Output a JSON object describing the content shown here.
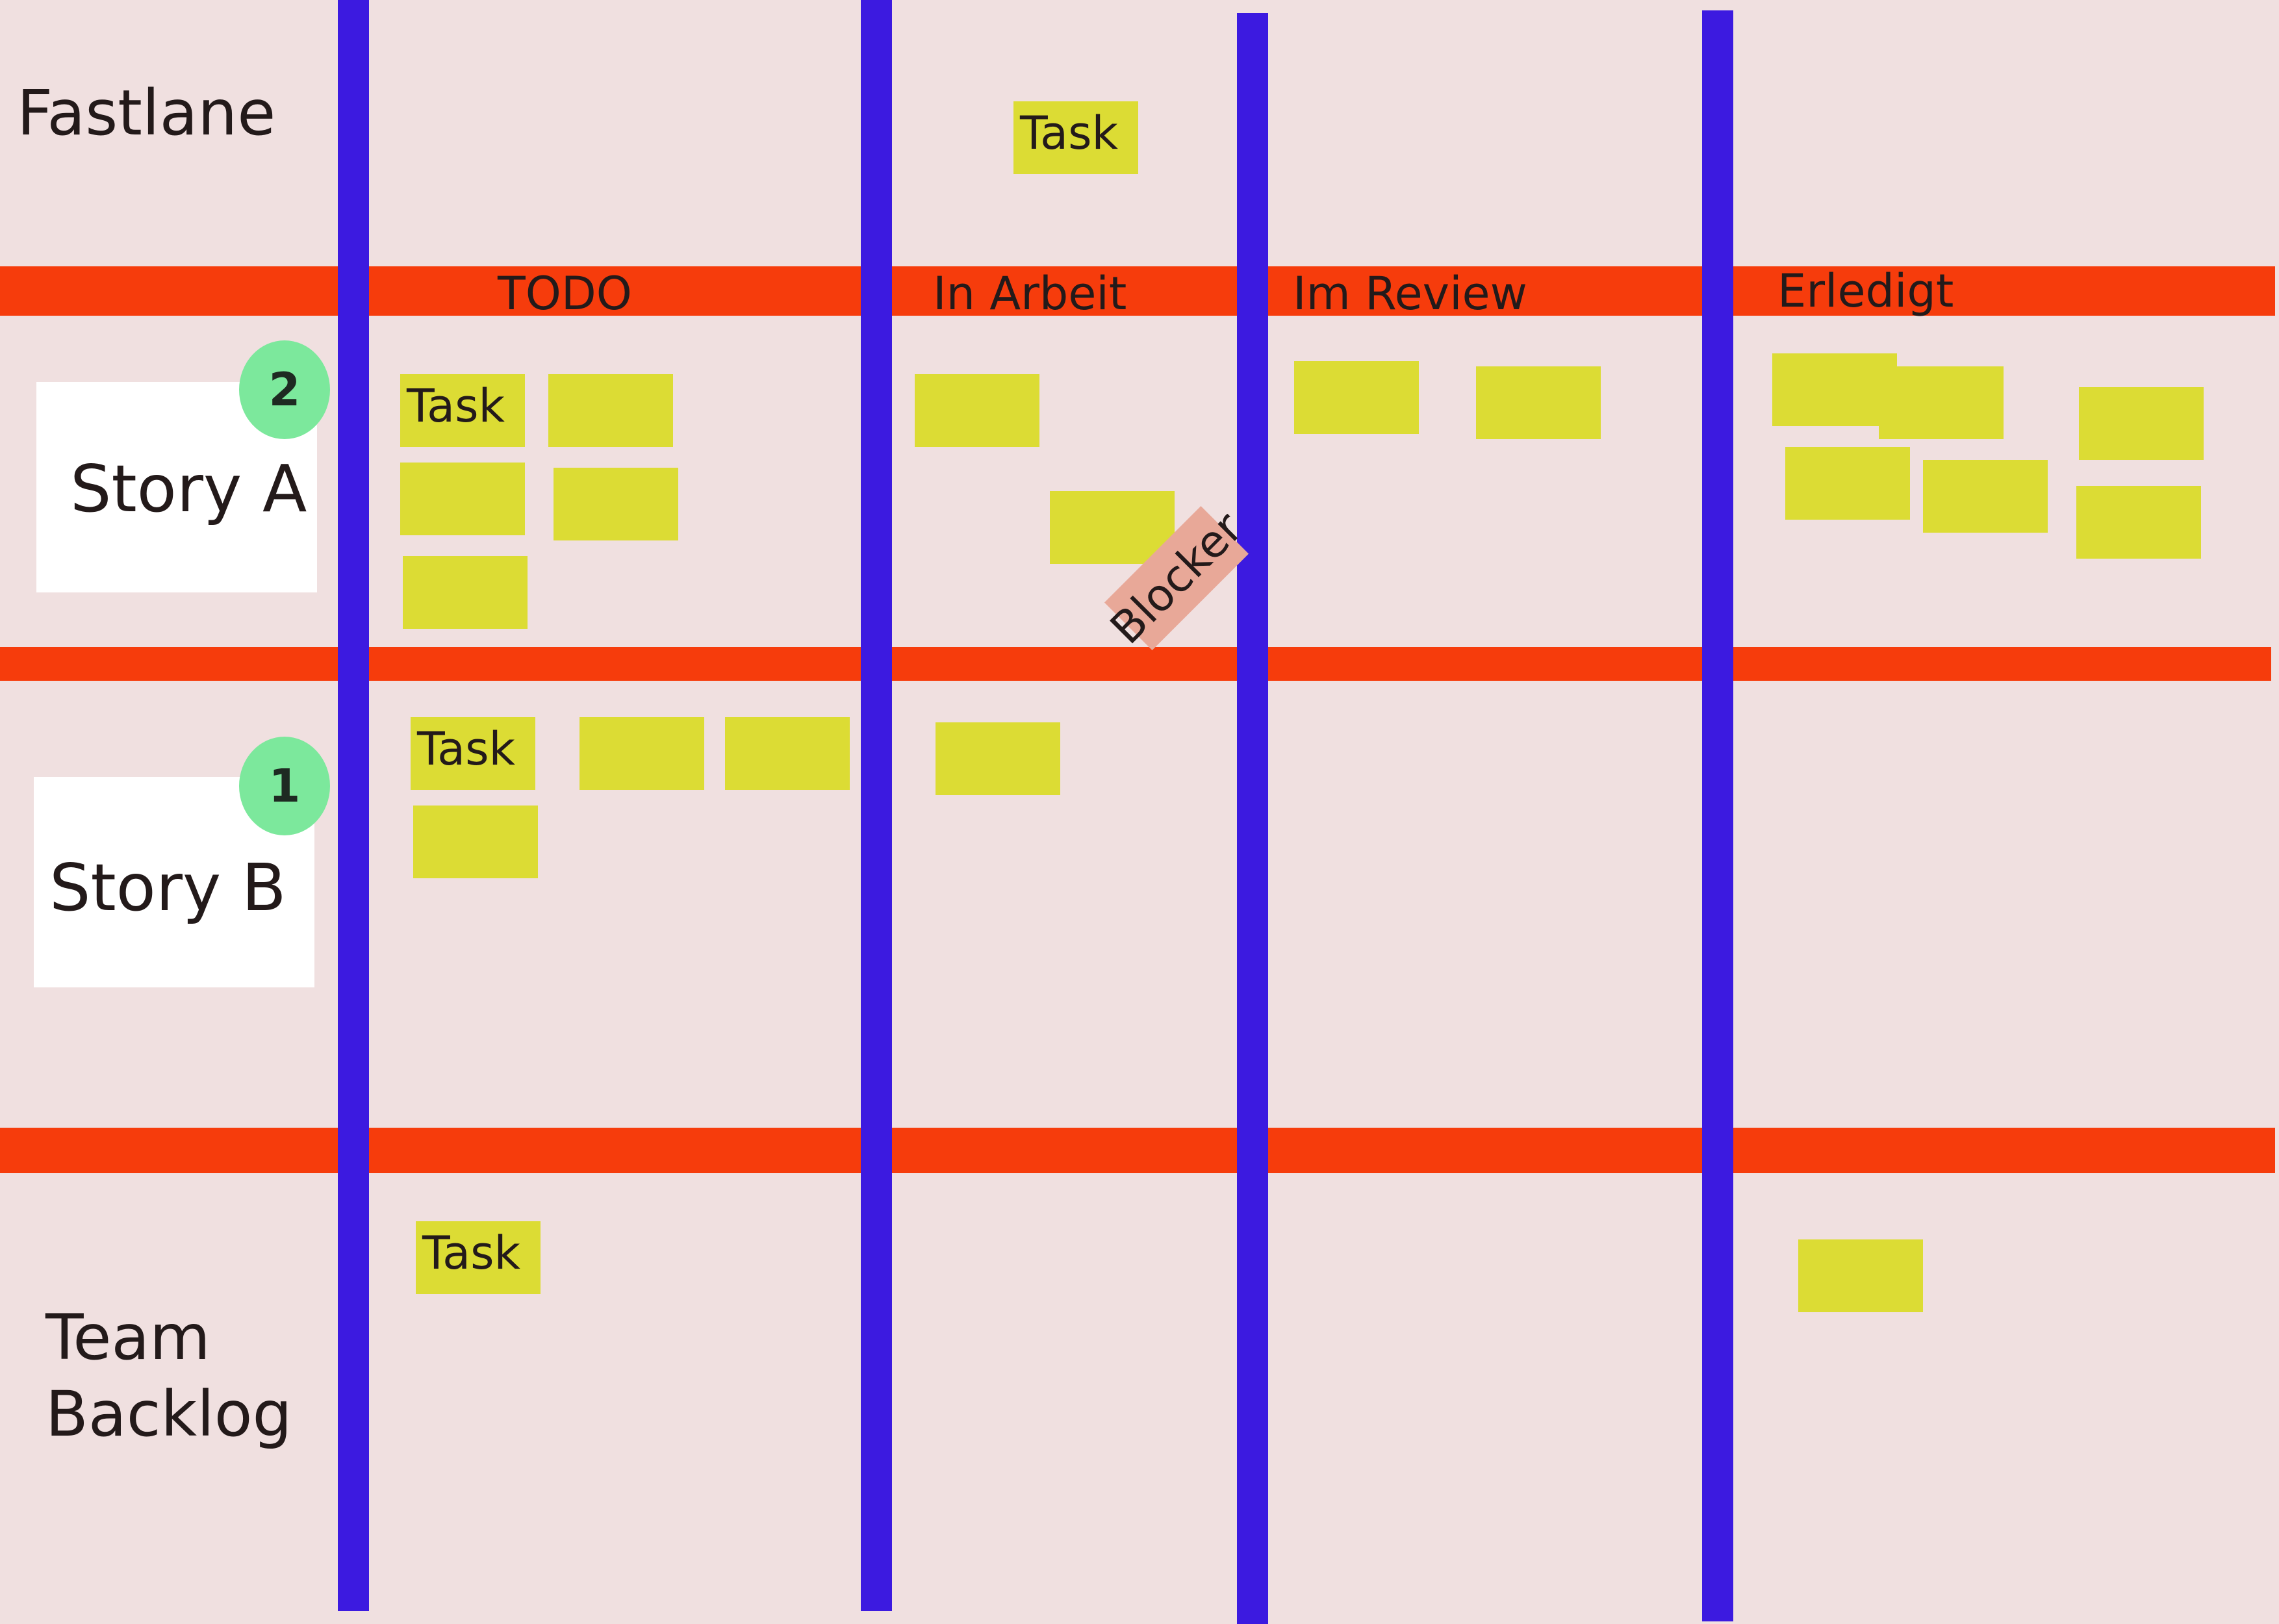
{
  "lanes": {
    "fastlane": "Fastlane",
    "story_a": "Story A",
    "story_b": "Story B",
    "team_backlog_line1": "Team",
    "team_backlog_line2": "Backlog"
  },
  "columns": [
    "TODO",
    "In Arbeit",
    "Im Review",
    "Erledigt"
  ],
  "badges": {
    "story_a": "2",
    "story_b": "1"
  },
  "task_label": "Task",
  "blocker_label": "Blocker",
  "colors": {
    "background": "#f0e0e0",
    "lane_divider": "#f63c0c",
    "column_divider": "#3c1ae0",
    "sticky_note": "#dcdc34",
    "blocker_note": "#e8a898",
    "badge": "#7ce89c",
    "story_card": "#ffffff"
  }
}
